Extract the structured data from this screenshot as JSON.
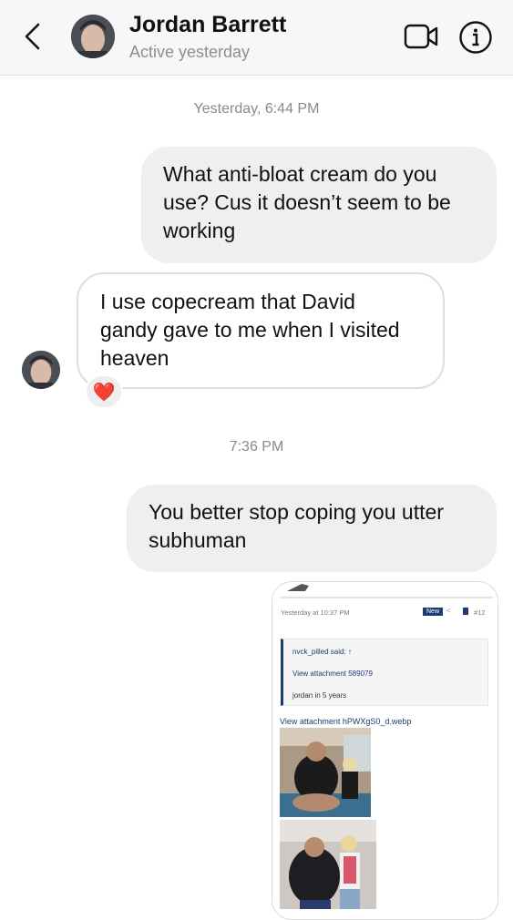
{
  "header": {
    "contact_name": "Jordan Barrett",
    "status": "Active yesterday",
    "icons": {
      "back": "chevron-left-icon",
      "video": "video-camera-icon",
      "info": "info-icon"
    }
  },
  "messages": {
    "timestamp_1": "Yesterday, 6:44 PM",
    "outgoing_1": "What anti-bloat cream do you\nuse? Cus it doesn’t seem to be\nworking",
    "incoming_1": "I use copecream that David\ngandy gave to me when I visited\nheaven",
    "reaction_1": "❤️",
    "timestamp_2": "7:36 PM",
    "outgoing_2": "You better stop coping you utter\nsubhuman"
  },
  "attachment": {
    "date": "Yesterday at 10:37 PM",
    "badge": "New",
    "post_number": "#12",
    "quote_author": "nvck_pilled said: ↑",
    "quote_attachment": "View attachment 589079",
    "quote_text": "jordan in 5 years",
    "attachment_link": "View attachment hPWXgS0_d.webp"
  },
  "colors": {
    "bubble_out": "#efefef",
    "bubble_in_border": "#dedede",
    "muted": "#8e8e8e",
    "forum_accent": "#1f3b74"
  }
}
